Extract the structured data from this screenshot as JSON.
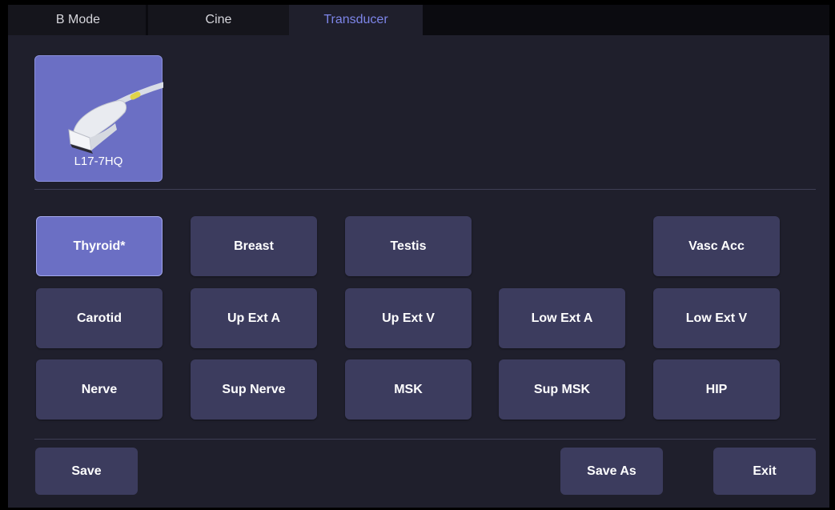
{
  "tabs": [
    {
      "label": "B Mode",
      "active": false
    },
    {
      "label": "Cine",
      "active": false
    },
    {
      "label": "Transducer",
      "active": true
    }
  ],
  "transducer": {
    "name": "L17-7HQ",
    "icon": "linear-probe-icon"
  },
  "presets": {
    "row1": [
      "Thyroid*",
      "Breast",
      "Testis",
      "Vasc Acc"
    ],
    "row2": [
      "Carotid",
      "Up Ext A",
      "Up Ext V",
      "Low Ext A",
      "Low Ext V"
    ],
    "row3": [
      "Nerve",
      "Sup Nerve",
      "MSK",
      "Sup MSK",
      "HIP"
    ],
    "selected": "Thyroid*"
  },
  "actions": {
    "save": "Save",
    "save_as": "Save As",
    "exit": "Exit"
  },
  "colors": {
    "accent": "#6b6fc4",
    "active_tab_text": "#7d85e8",
    "button": "#3c3c5e",
    "background": "#1f1f2c"
  }
}
